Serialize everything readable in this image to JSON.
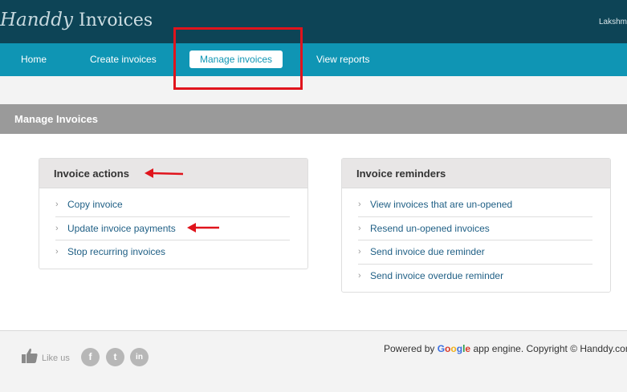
{
  "app": {
    "logo_script": "Handdy",
    "logo_rest": " Invoices",
    "user": "Lakshm"
  },
  "nav": {
    "items": [
      {
        "label": "Home"
      },
      {
        "label": "Create invoices"
      },
      {
        "label": "Manage invoices",
        "active": true
      },
      {
        "label": "View reports"
      }
    ]
  },
  "page": {
    "title": "Manage Invoices"
  },
  "invoice_actions": {
    "title": "Invoice actions",
    "items": [
      "Copy invoice",
      "Update invoice payments",
      "Stop recurring invoices"
    ]
  },
  "invoice_reminders": {
    "title": "Invoice reminders",
    "items": [
      "View invoices that are un-opened",
      "Resend un-opened invoices",
      "Send invoice due reminder",
      "Send invoice overdue reminder"
    ]
  },
  "footer": {
    "like_us": "Like us",
    "social": [
      "f",
      "t",
      "in"
    ],
    "powered_prefix": "Powered by ",
    "google": [
      "G",
      "o",
      "o",
      "g",
      "l",
      "e"
    ],
    "powered_suffix": " app engine. Copyright © Handdy.com"
  },
  "colors": {
    "topbar": "#0d4456",
    "nav": "#0f95b4",
    "link": "#1f5f85",
    "annotation": "#e0141c"
  },
  "icons": {
    "item_bullet": "chevron-right-icon",
    "like": "thumbs-up-icon",
    "annotation_arrow": "arrow-left-icon"
  }
}
